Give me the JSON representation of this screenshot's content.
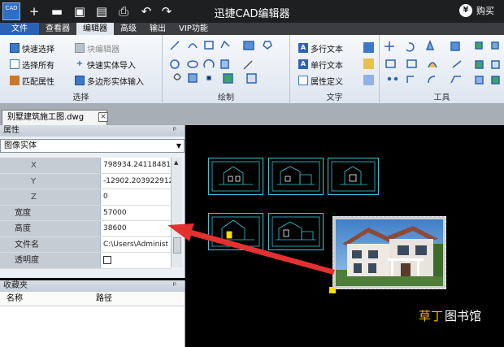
{
  "app": {
    "logo_text": "CAD",
    "title": "迅捷CAD编辑器",
    "buy_label": "购买",
    "buy_icon": "¥"
  },
  "menu_tabs": [
    "文件",
    "查看器",
    "编辑器",
    "高级",
    "输出",
    "VIP功能"
  ],
  "active_tab": "编辑器",
  "ribbon": {
    "select_group": {
      "label": "选择",
      "items": [
        "快速选择",
        "选择所有",
        "匹配属性"
      ]
    },
    "block_group": {
      "items": [
        "块编辑器",
        "快速实体导入",
        "多边形实体输入"
      ]
    },
    "draw_group": {
      "label": "绘制"
    },
    "text_group": {
      "label": "文字",
      "items": [
        "多行文本",
        "单行文本",
        "属性定义"
      ]
    },
    "tools_group": {
      "label": "工具"
    }
  },
  "document": {
    "tab_name": "别墅建筑施工图.dwg",
    "close_glyph": "×"
  },
  "properties": {
    "panel_title": "属性",
    "pin_glyph": "ᵖ",
    "object_type": "图像实体",
    "rows": [
      {
        "name": "X",
        "value": "798934.241184819"
      },
      {
        "name": "Y",
        "value": "-12902.203922912"
      },
      {
        "name": "Z",
        "value": "0"
      },
      {
        "name": "宽度",
        "value": "57000"
      },
      {
        "name": "高度",
        "value": "38600"
      },
      {
        "name": "文件名",
        "value": "C:\\Users\\Administ"
      },
      {
        "name": "透明度",
        "value": ""
      }
    ]
  },
  "favorites": {
    "panel_title": "收藏夹",
    "columns": [
      "名称",
      "路径"
    ]
  },
  "watermark": {
    "part1": "草丁",
    "part2": "图书馆"
  },
  "colors": {
    "file_tab": "#2a63b5",
    "drawing_lines": "#37c9d8",
    "arrow": "#e53030",
    "grip": "#ffde00"
  }
}
